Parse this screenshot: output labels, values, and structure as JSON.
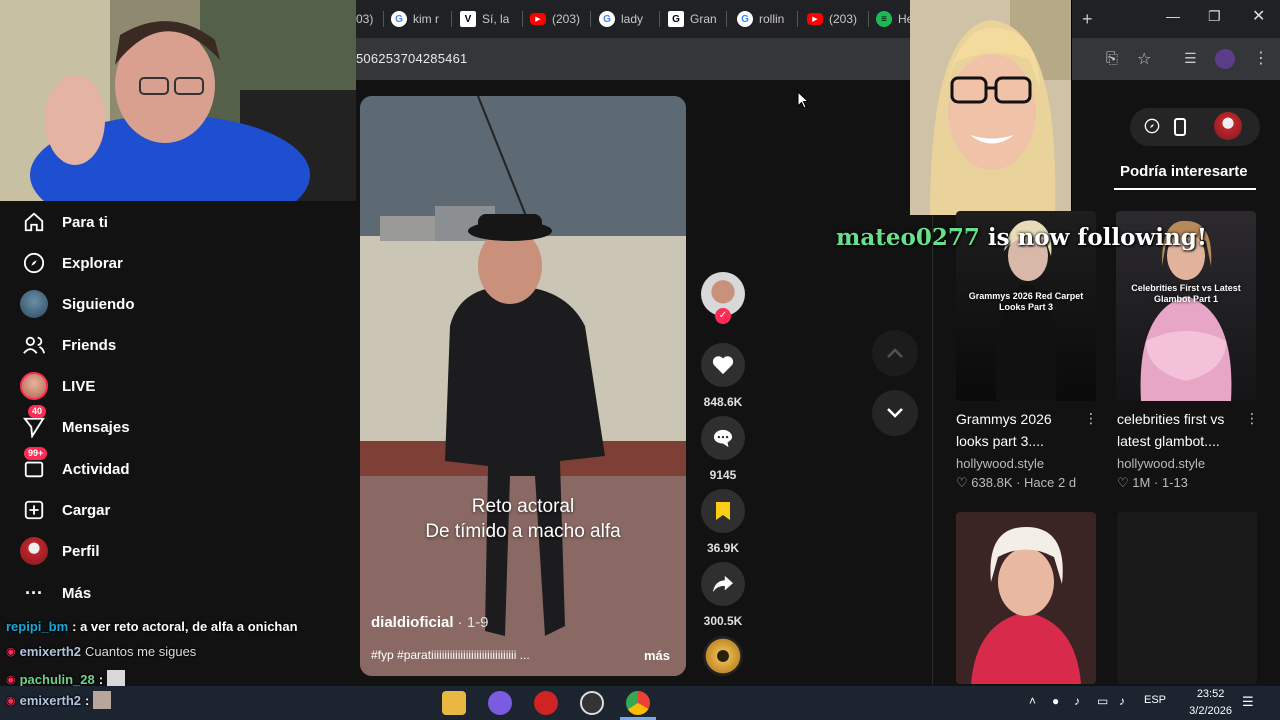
{
  "browser": {
    "tabs": [
      {
        "label": "03)",
        "icon": "youtube-icon"
      },
      {
        "label": "kim r",
        "icon": "google-icon"
      },
      {
        "label": "Sí, la",
        "icon": "vogue-icon"
      },
      {
        "label": "(203)",
        "icon": "youtube-icon"
      },
      {
        "label": "lady",
        "icon": "google-icon"
      },
      {
        "label": "Gran",
        "icon": "grammy-icon"
      },
      {
        "label": "rollin",
        "icon": "google-icon"
      },
      {
        "label": "(203)",
        "icon": "youtube-icon"
      },
      {
        "label": "He",
        "icon": "spotify-icon"
      }
    ],
    "new_tab": "+",
    "url": "506253704285461"
  },
  "sidebar": {
    "items": [
      {
        "label": "Para ti",
        "icon": "home-icon"
      },
      {
        "label": "Explorar",
        "icon": "compass-icon"
      },
      {
        "label": "Siguiendo",
        "icon": "avatar"
      },
      {
        "label": "Friends",
        "icon": "friends-icon"
      },
      {
        "label": "LIVE",
        "icon": "live-avatar"
      },
      {
        "label": "Mensajes",
        "icon": "messages-icon",
        "badge": "40"
      },
      {
        "label": "Actividad",
        "icon": "activity-icon",
        "badge": "99+"
      },
      {
        "label": "Cargar",
        "icon": "upload-icon"
      },
      {
        "label": "Perfil",
        "icon": "profile-avatar"
      },
      {
        "label": "Más",
        "icon": "more-icon"
      }
    ]
  },
  "chat": {
    "lines": [
      {
        "user": "repipi_bm",
        "text": ": a ver reto actoral, de alfa a onichan"
      },
      {
        "user": "emixerth2",
        "text": "Cuantos me sigues"
      },
      {
        "user": "pachulin_28",
        "text": ":"
      },
      {
        "user": "emixerth2",
        "text": ":"
      }
    ]
  },
  "video": {
    "caption_line1": "Reto actoral",
    "caption_line2": "De tímido a macho alfa",
    "author": "dialdioficial",
    "date": " · 1-9",
    "description": "#fyp #paratiiiiiiiiiiiiiiiiiiiiiiiiiiiiiiii ...",
    "more": "más"
  },
  "actions": {
    "likes": "848.6K",
    "comments": "9145",
    "saves": "36.9K",
    "shares": "300.5K"
  },
  "suggestions": {
    "title": "Podría interesarte",
    "cards": [
      {
        "title1": "Grammys 2026",
        "title2": "looks part 3....",
        "author": "hollywood.style",
        "meta": "638.8K · Hace 2 d",
        "overlay": "Grammys 2026 Red Carpet Looks Part 3"
      },
      {
        "title1": "celebrities first vs",
        "title2": "latest glambot....",
        "author": "hollywood.style",
        "meta": "1M · 1-13",
        "overlay": "Celebrities First vs Latest Glambot Part 1"
      }
    ]
  },
  "alert": {
    "user": "mateo0277",
    "message": " is now following!"
  },
  "taskbar": {
    "time": "23:52",
    "date": "3/2/2026",
    "lang": "ESP"
  },
  "colors": {
    "accent": "#fe2c55",
    "chat_user": "#1aa6d8",
    "alert_user": "#68e08a",
    "save_yellow": "#face15"
  }
}
